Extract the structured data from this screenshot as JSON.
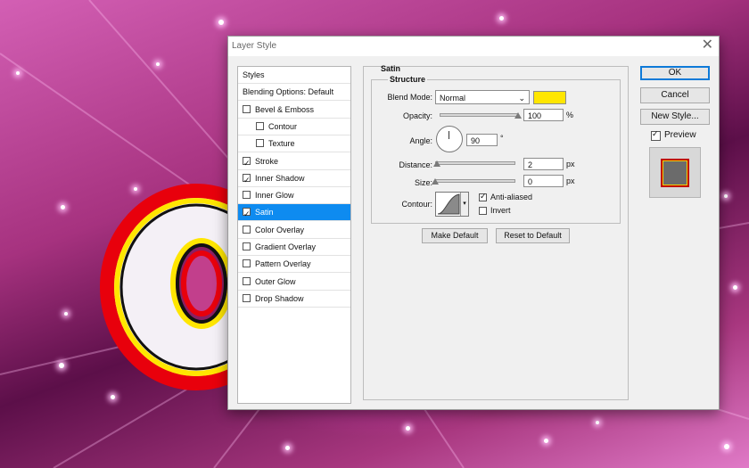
{
  "dialog": {
    "title": "Layer Style",
    "close_glyph": "✕"
  },
  "styles_list": [
    {
      "label": "Styles",
      "checkbox": false,
      "checked": false,
      "indent": 0,
      "selected": false
    },
    {
      "label": "Blending Options: Default",
      "checkbox": false,
      "checked": false,
      "indent": 0,
      "selected": false
    },
    {
      "label": "Bevel & Emboss",
      "checkbox": true,
      "checked": false,
      "indent": 0,
      "selected": false
    },
    {
      "label": "Contour",
      "checkbox": true,
      "checked": false,
      "indent": 1,
      "selected": false
    },
    {
      "label": "Texture",
      "checkbox": true,
      "checked": false,
      "indent": 1,
      "selected": false
    },
    {
      "label": "Stroke",
      "checkbox": true,
      "checked": true,
      "indent": 0,
      "selected": false
    },
    {
      "label": "Inner Shadow",
      "checkbox": true,
      "checked": true,
      "indent": 0,
      "selected": false
    },
    {
      "label": "Inner Glow",
      "checkbox": true,
      "checked": false,
      "indent": 0,
      "selected": false
    },
    {
      "label": "Satin",
      "checkbox": true,
      "checked": true,
      "indent": 0,
      "selected": true
    },
    {
      "label": "Color Overlay",
      "checkbox": true,
      "checked": false,
      "indent": 0,
      "selected": false
    },
    {
      "label": "Gradient Overlay",
      "checkbox": true,
      "checked": false,
      "indent": 0,
      "selected": false
    },
    {
      "label": "Pattern Overlay",
      "checkbox": true,
      "checked": false,
      "indent": 0,
      "selected": false
    },
    {
      "label": "Outer Glow",
      "checkbox": true,
      "checked": false,
      "indent": 0,
      "selected": false
    },
    {
      "label": "Drop Shadow",
      "checkbox": true,
      "checked": false,
      "indent": 0,
      "selected": false
    }
  ],
  "satin": {
    "section_title": "Satin",
    "structure_title": "Structure",
    "blend_mode_label": "Blend Mode:",
    "blend_mode_value": "Normal",
    "color": "#ffe600",
    "opacity_label": "Opacity:",
    "opacity_value": "100",
    "opacity_unit": "%",
    "opacity_fraction": 1.0,
    "angle_label": "Angle:",
    "angle_value": "90",
    "angle_unit": "°",
    "distance_label": "Distance:",
    "distance_value": "2",
    "distance_unit": "px",
    "distance_fraction": 0.02,
    "size_label": "Size:",
    "size_value": "0",
    "size_unit": "px",
    "size_fraction": 0.0,
    "contour_label": "Contour:",
    "anti_aliased_label": "Anti-aliased",
    "anti_aliased_checked": true,
    "invert_label": "Invert",
    "invert_checked": false,
    "make_default_label": "Make Default",
    "reset_default_label": "Reset to Default"
  },
  "actions": {
    "ok_label": "OK",
    "cancel_label": "Cancel",
    "new_style_label": "New Style...",
    "preview_label": "Preview",
    "preview_checked": true
  }
}
